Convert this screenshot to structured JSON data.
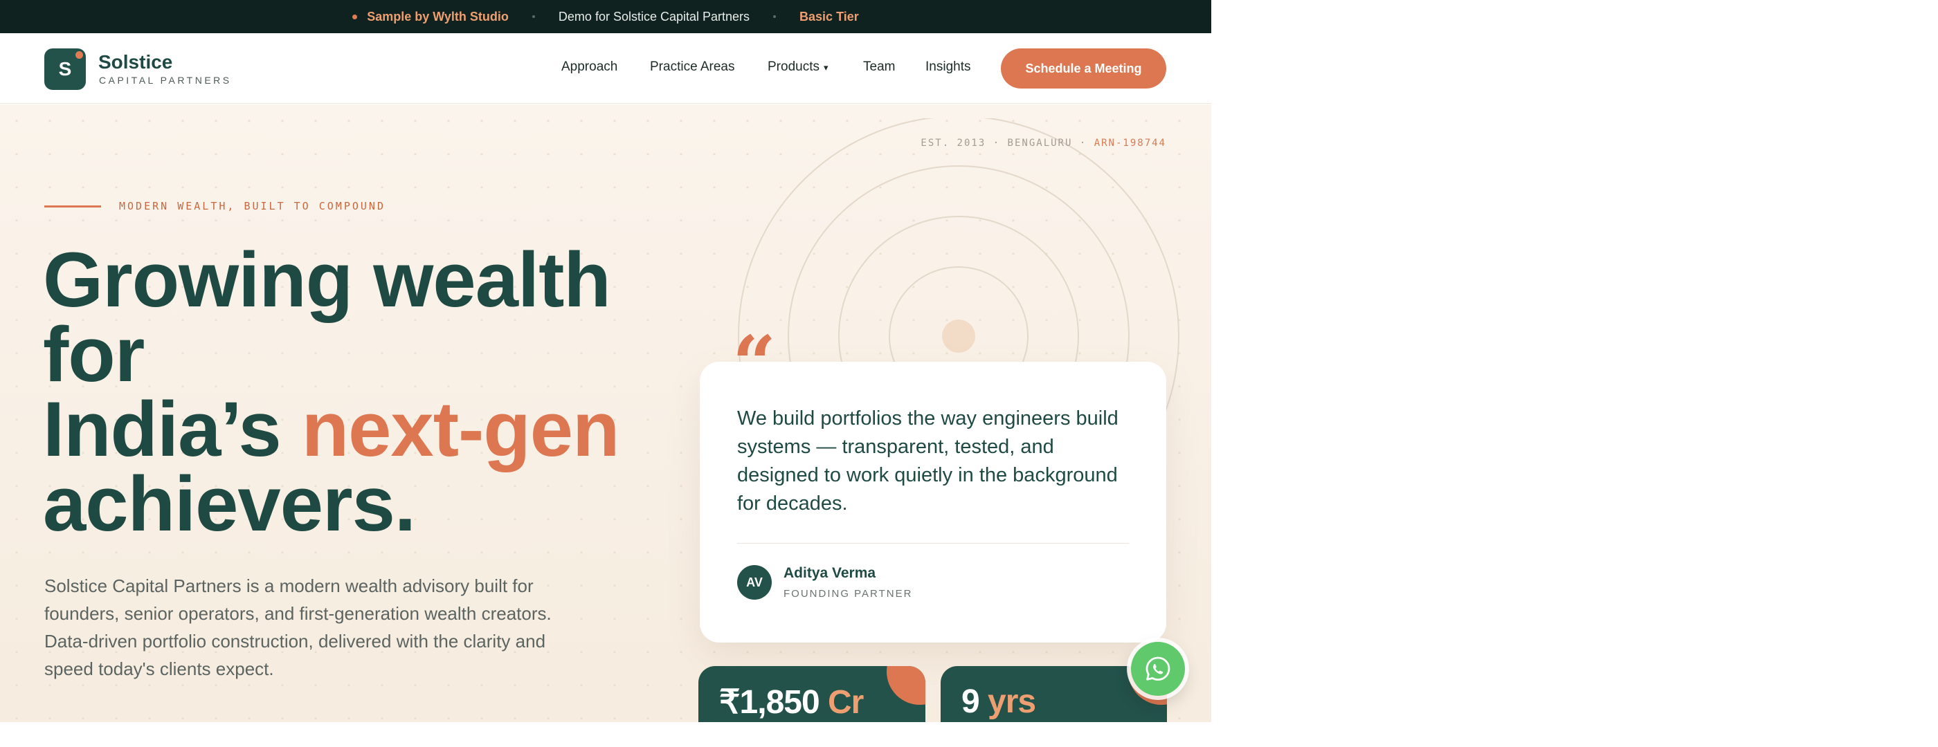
{
  "topbar": {
    "brand": "Sample by Wylth Studio",
    "demo": "Demo for Solstice Capital Partners",
    "tier": "Basic Tier"
  },
  "logo": {
    "mark": "S",
    "name": "Solstice",
    "sub": "CAPITAL PARTNERS"
  },
  "nav": {
    "items": [
      "Approach",
      "Practice Areas",
      "Products",
      "Team",
      "Insights"
    ],
    "products_caret": "▾",
    "cta": "Schedule a Meeting"
  },
  "hero": {
    "meta_left": "EST. 2013 · BENGALURU · ",
    "meta_arn": "ARN-198744",
    "eyebrow": "MODERN WEALTH, BUILT TO COMPOUND",
    "headline": {
      "line1": "Growing wealth",
      "line2": "for",
      "line3_pre": "India’s ",
      "line3_accent": "next-gen",
      "line4": "achievers."
    },
    "lede": "Solstice Capital Partners is a modern wealth advisory built for founders, senior operators, and first-generation wealth creators. Data-driven portfolio construction, delivered with the clarity and speed today's clients expect."
  },
  "quote": {
    "mark": "“",
    "text": "We build portfolios the way engineers build systems — transparent, tested, and designed to work quietly in the background for decades.",
    "initials": "AV",
    "author": "Aditya Verma",
    "role": "FOUNDING PARTNER"
  },
  "stats": [
    {
      "value": "₹1,850",
      "unit": "Cr"
    },
    {
      "value": "9",
      "unit": "yrs"
    }
  ],
  "icons": {
    "whatsapp": "whatsapp-icon",
    "chevron": "chevron-down-icon"
  },
  "colors": {
    "brand_green": "#23524a",
    "accent_orange": "#dc7752",
    "topbar_bg": "#10221f",
    "whatsapp_green": "#5fc96b"
  }
}
